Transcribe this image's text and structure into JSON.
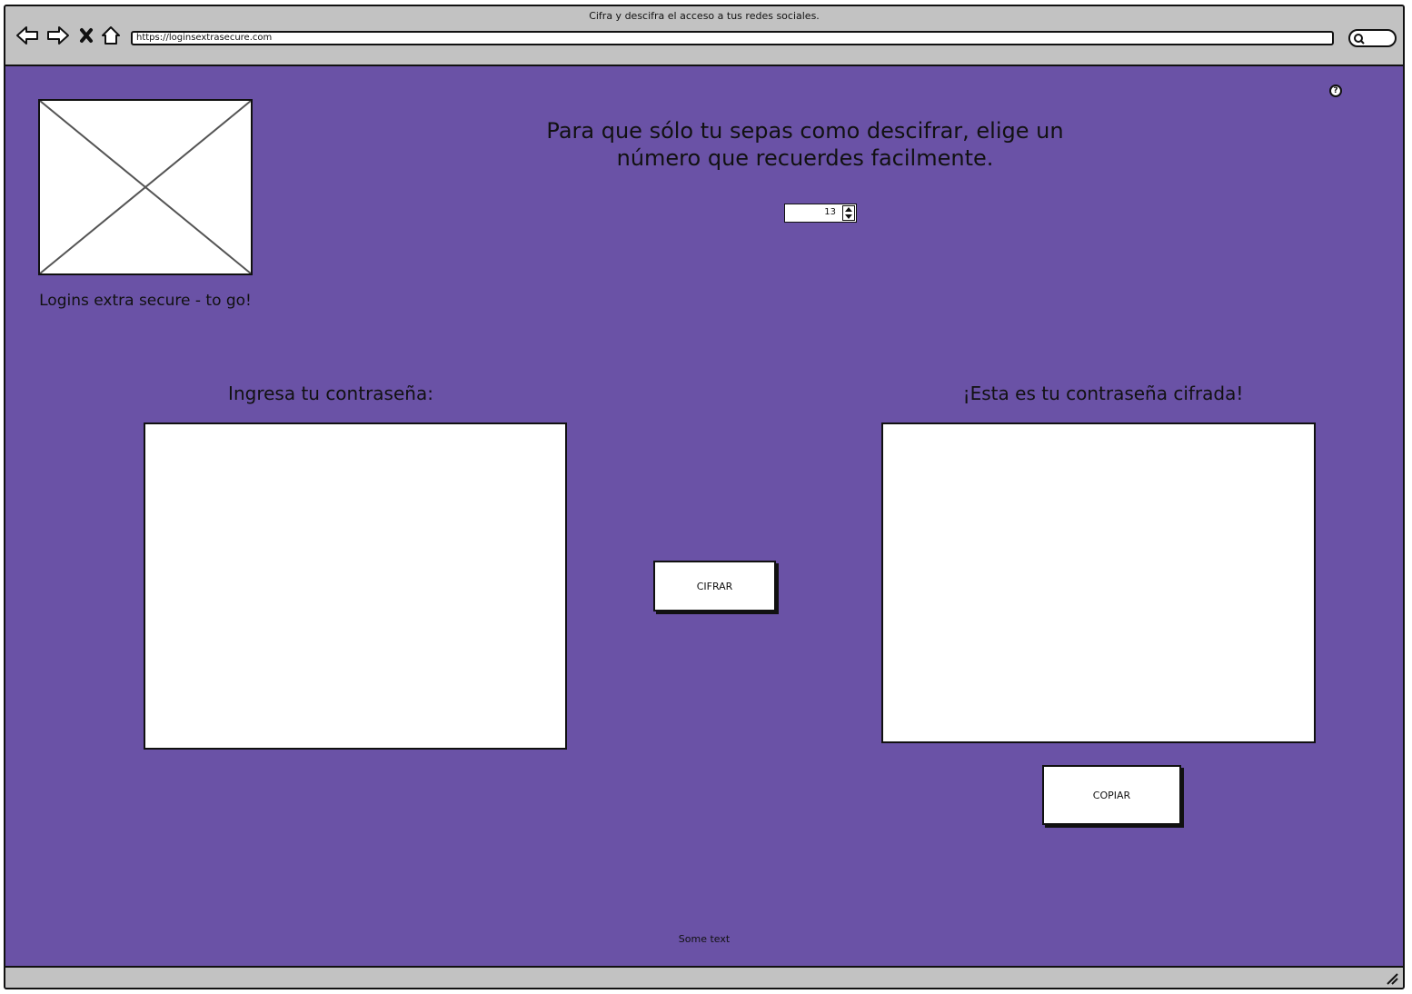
{
  "window": {
    "title": "Cifra y descifra el acceso a tus redes sociales.",
    "url": "https://loginsextrasecure.com"
  },
  "icons": {
    "back": "arrow-left-icon",
    "forward": "arrow-right-icon",
    "stop": "close-icon",
    "home": "home-icon",
    "search": "search-icon",
    "help": "question-icon",
    "resize": "resize-grip-icon"
  },
  "brand": {
    "logo_caption": "Logins extra secure - to go!"
  },
  "help": {
    "symbol": "?"
  },
  "instruction": {
    "line1": "Para que sólo tu sepas como descifrar, elige un",
    "line2": "número que recuerdes facilmente."
  },
  "key_stepper": {
    "value": "13"
  },
  "input_panel": {
    "label": "Ingresa tu contraseña:",
    "value": ""
  },
  "output_panel": {
    "label": "¡Esta es tu contraseña cifrada!",
    "value": ""
  },
  "buttons": {
    "encrypt": "CIFRAR",
    "copy": "COPIAR"
  },
  "footer": {
    "text": "Some text"
  },
  "colors": {
    "background": "#6a52a6",
    "chrome": "#c2c2c2",
    "panel": "#ffffff",
    "ink": "#111111"
  }
}
